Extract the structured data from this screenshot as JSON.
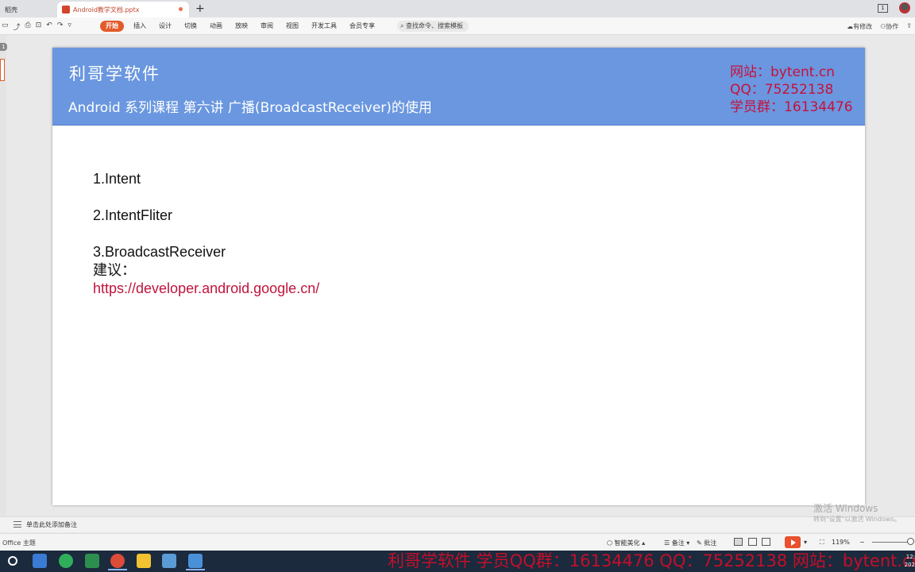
{
  "tabs": [
    {
      "label": "稻壳"
    },
    {
      "label": "Android教学文档.pptx"
    }
  ],
  "toolbar": {
    "menus": [
      "开始",
      "插入",
      "设计",
      "切换",
      "动画",
      "放映",
      "审阅",
      "视图",
      "开发工具",
      "会员专享"
    ],
    "search_placeholder": "查找命令、搜索模板",
    "right": [
      "有修改",
      "协作"
    ]
  },
  "thumbs": {
    "current": "1"
  },
  "slide": {
    "brand": "利哥学软件",
    "course_title": "Android 系列课程 第六讲 广播(BroadcastReceiver)的使用",
    "contact": [
      "网站：bytent.cn",
      "QQ：75252138",
      "学员群：16134476"
    ],
    "items": [
      "1.Intent",
      "2.IntentFliter",
      "3.BroadcastReceiver"
    ],
    "suggestion_label": "建议：",
    "link": "https://developer.android.google.cn/"
  },
  "notes": {
    "placeholder": "单击此处添加备注"
  },
  "watermark": {
    "line1": "激活 Windows",
    "line2": "转到\"设置\"以激活 Windows。"
  },
  "statusbar": {
    "theme": "Office 主题",
    "beautify": "智能美化",
    "notes_btn": "备注",
    "comments_btn": "批注",
    "zoom": "119%"
  },
  "taskbar": {
    "ticker": "利哥学软件 学员QQ群：16134476 QQ：75252138 网站：bytent.cn",
    "clock_time": "12:",
    "clock_date": "202"
  },
  "colors": {
    "header_blue": "#6a97df",
    "contact_red": "#c8103c",
    "accent_orange": "#e25b2a"
  }
}
